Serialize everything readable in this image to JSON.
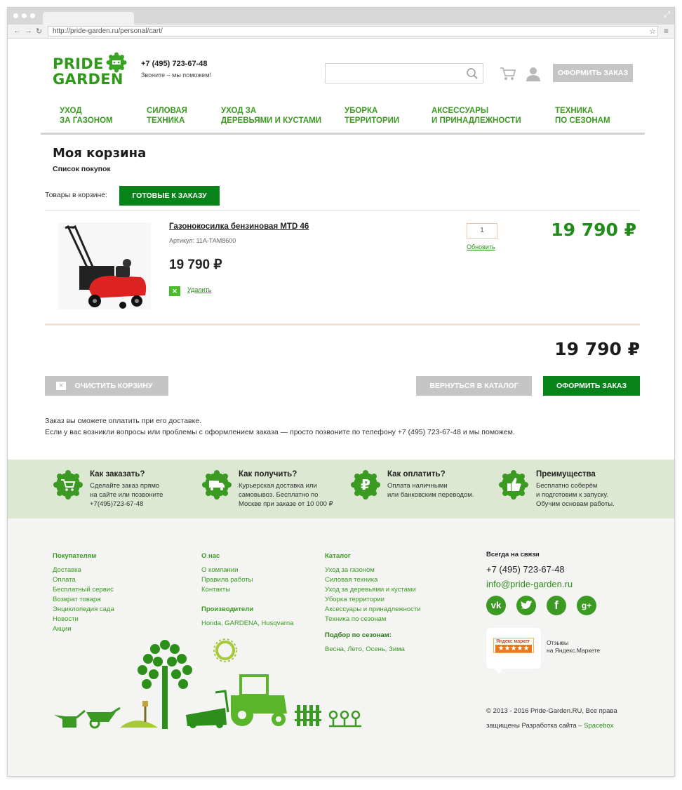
{
  "browser": {
    "url": "http://pride-garden.ru/personal/cart/"
  },
  "header": {
    "logo_line1": "PRIDE",
    "logo_line2": "GARDEN",
    "phone": "+7 (495) 723-67-48",
    "phone_sub": "Звоните – мы поможем!",
    "search_placeholder": "",
    "order_button": "Оформить заказ"
  },
  "categories": [
    {
      "line1": "Уход",
      "line2": "за газоном"
    },
    {
      "line1": "Силовая",
      "line2": "техника"
    },
    {
      "line1": "Уход за",
      "line2": "деревьями и кустами"
    },
    {
      "line1": "Уборка",
      "line2": "территории"
    },
    {
      "line1": "Аксессуары",
      "line2": "и принадлежности"
    },
    {
      "line1": "Техника",
      "line2": "по сезонам"
    }
  ],
  "cart": {
    "title": "Моя корзина",
    "subtitle": "Список покупок",
    "items_label": "Товары в корзине:",
    "ready_tab": "Готовые к заказу",
    "item": {
      "name": "Газонокосилка бензиновая MTD 46",
      "article": "Артикул: 11А-TAM8600",
      "price": "19 790 ₽",
      "delete": "Удалить",
      "qty": "1",
      "update": "Обновить",
      "sum": "19 790 ₽"
    },
    "total": "19 790 ₽",
    "clear_button": "Очистить корзину",
    "back_button": "Вернуться в каталог",
    "order_button": "Оформить заказ",
    "note1": "Заказ вы сможете оплатить при его доставке.",
    "note2": "Если у вас возникли вопросы или проблемы с оформлением заказа — просто позвоните по телефону +7 (495) 723-67-48 и мы поможем."
  },
  "info": [
    {
      "title": "Как заказать?",
      "lines": [
        "Сделайте заказ прямо",
        "на сайте или позвоните",
        "+7(495)723-67-48"
      ],
      "icon": "cart-icon"
    },
    {
      "title": "Как получить?",
      "lines": [
        "Курьерская доставка или",
        "самовывоз. Бесплатно по",
        "Москве при заказе от 10 000 ₽"
      ],
      "icon": "truck-icon"
    },
    {
      "title": "Как оплатить?",
      "lines": [
        "Оплата наличными",
        "или банковским переводом."
      ],
      "icon": "ruble-icon"
    },
    {
      "title": "Преимущества",
      "lines": [
        "Бесплатно соберём",
        "и подготовим к запуску.",
        "Обучим основам работы."
      ],
      "icon": "thumbs-up-icon"
    }
  ],
  "footer": {
    "buyers": {
      "title": "Покупателям",
      "links": [
        "Доставка",
        "Оплата",
        "Бесплатный сервис",
        "Возврат товара",
        "Энциклопедия сада",
        "Новости",
        "Акции"
      ]
    },
    "about": {
      "title": "О нас",
      "links": [
        "О компании",
        "Правила работы",
        "Контакты"
      ]
    },
    "makers": {
      "title": "Производители",
      "links": [
        "Honda, GARDENA, Husqvarna"
      ]
    },
    "catalog": {
      "title": "Каталог",
      "links": [
        "Уход за газоном",
        "Силовая техника",
        "Уход за деревьями и кустами",
        "Уборка территории",
        "Аксессуары и принадлежности",
        "Техника по сезонам"
      ]
    },
    "seasons": {
      "title": "Подбор по сезонам:",
      "links": [
        "Весна, Лето, Осень, Зима"
      ]
    },
    "contact_title": "Всегда на связи",
    "phone": "+7 (495) 723-67-48",
    "email": "info@pride-garden.ru",
    "social": [
      "vk",
      "twitter",
      "f",
      "g+"
    ],
    "ym_badge_top": "Яндекс маркет",
    "ym_stars": "★★★★★",
    "ym_text1": "Отзывы",
    "ym_text2": "на Яндекс.Маркете",
    "copy1": "© 2013 - 2016 Pride-Garden.RU, Все права",
    "copy2": "защищены Разработка сайта –",
    "copy_link": "Spacebox"
  },
  "colors": {
    "brand_green": "#078319",
    "light_green": "#3a9a22",
    "grey_button": "#c5c5c5",
    "info_bg": "#dde8d3"
  }
}
